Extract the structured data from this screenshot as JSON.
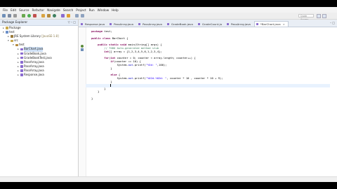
{
  "menu": [
    "File",
    "Edit",
    "Source",
    "Refactor",
    "Navigate",
    "Search",
    "Project",
    "Run",
    "Window",
    "Help"
  ],
  "quick_access": "Quick Access",
  "package_explorer": {
    "title": "Package Explorer",
    "controls": "▽ – □",
    "tree": [
      {
        "label": "Package",
        "indent": 0,
        "icon": "folder-icon",
        "twisty": "▸",
        "color": "#c9a84a"
      },
      {
        "label": "test",
        "indent": 0,
        "icon": "project-icon",
        "twisty": "▾",
        "color": "#6b8fc9"
      },
      {
        "label": "JRE System Library",
        "suffix": " [JavaSE-1.8]",
        "indent": 1,
        "icon": "library-icon",
        "twisty": "▸",
        "color": "#9b7b3a"
      },
      {
        "label": "src",
        "indent": 1,
        "icon": "source-folder-icon",
        "twisty": "▾",
        "color": "#c9a84a"
      },
      {
        "label": "test",
        "indent": 2,
        "icon": "package-icon",
        "twisty": "▾",
        "color": "#b58a3c"
      },
      {
        "label": "BarChart.java",
        "indent": 3,
        "icon": "java-file-icon",
        "twisty": "▸",
        "color": "#8a6bd0",
        "selected": true
      },
      {
        "label": "GradeBook.java",
        "indent": 3,
        "icon": "java-file-icon",
        "twisty": "▸",
        "color": "#8a6bd0"
      },
      {
        "label": "GradeBookTest.java",
        "indent": 3,
        "icon": "java-file-icon",
        "twisty": "▸",
        "color": "#8a6bd0"
      },
      {
        "label": "PassArray.java",
        "indent": 3,
        "icon": "java-file-icon",
        "twisty": "▸",
        "color": "#8a6bd0"
      },
      {
        "label": "PassArray.java",
        "indent": 3,
        "icon": "java-file-icon",
        "twisty": "▸",
        "color": "#8a6bd0"
      },
      {
        "label": "PassArray.java",
        "indent": 3,
        "icon": "java-file-icon",
        "twisty": "▸",
        "color": "#8a6bd0"
      },
      {
        "label": "Response.java",
        "indent": 3,
        "icon": "java-file-icon",
        "twisty": "▸",
        "color": "#8a6bd0"
      }
    ]
  },
  "tabs": [
    {
      "label": "Response.java",
      "active": false
    },
    {
      "label": "PassArray.java",
      "active": false
    },
    {
      "label": "PassArray.java",
      "active": false
    },
    {
      "label": "GradeBook.java",
      "active": false
    },
    {
      "label": "GradeCount.ja",
      "active": false
    },
    {
      "label": "PassArray.java",
      "active": false
    },
    {
      "label": "*BarChart.java",
      "active": true
    }
  ],
  "tab_controls": "– □",
  "code_lines": [
    [
      [
        "kw",
        "package"
      ],
      [
        "t",
        " test;"
      ]
    ],
    [
      [
        "t",
        ""
      ]
    ],
    [
      [
        "kw",
        "public class"
      ],
      [
        "t",
        " BarChart {"
      ]
    ],
    [
      [
        "t",
        ""
      ]
    ],
    [
      [
        "t",
        "    "
      ],
      [
        "kw",
        "public static void"
      ],
      [
        "t",
        " main(String[] args) {"
      ]
    ],
    [
      [
        "t",
        "        "
      ],
      [
        "cm",
        "// TODO Auto-generated method stub"
      ]
    ],
    [
      [
        "t",
        "        "
      ],
      [
        "kw",
        "int"
      ],
      [
        "t",
        "[] array = {1,2,3,4,5,6,1,2,3,4};"
      ]
    ],
    [
      [
        "t",
        ""
      ]
    ],
    [
      [
        "t",
        "        "
      ],
      [
        "kw",
        "for"
      ],
      [
        "t",
        "("
      ],
      [
        "kw",
        "int"
      ],
      [
        "t",
        " counter = 0; counter < array.length; counter++) {"
      ]
    ],
    [
      [
        "t",
        "            "
      ],
      [
        "kw",
        "if"
      ],
      [
        "t",
        "(counter == 10) {"
      ]
    ],
    [
      [
        "t",
        "                System."
      ],
      [
        "fd",
        "out"
      ],
      [
        "t",
        ".printf("
      ],
      [
        "st",
        "\"%5d: \""
      ],
      [
        "t",
        ",100);"
      ]
    ],
    [
      [
        "t",
        "            }"
      ]
    ],
    [
      [
        "t",
        ""
      ]
    ],
    [
      [
        "t",
        "            "
      ],
      [
        "kw",
        "else"
      ],
      [
        "t",
        " {"
      ]
    ],
    [
      [
        "t",
        "                System."
      ],
      [
        "fd",
        "out"
      ],
      [
        "t",
        ".printf("
      ],
      [
        "st",
        "\"%02d-%02d: \""
      ],
      [
        "t",
        ", counter * 10 , counter * 10 + 9);"
      ]
    ],
    [
      [
        "t",
        "            }"
      ]
    ],
    [
      [
        "t",
        "            "
      ],
      [
        "caret",
        ""
      ]
    ],
    [
      [
        "t",
        "        }"
      ]
    ],
    [
      [
        "t",
        "    }"
      ]
    ],
    [
      [
        "t",
        ""
      ]
    ],
    [
      [
        "t",
        "}"
      ]
    ]
  ],
  "current_line": 16
}
